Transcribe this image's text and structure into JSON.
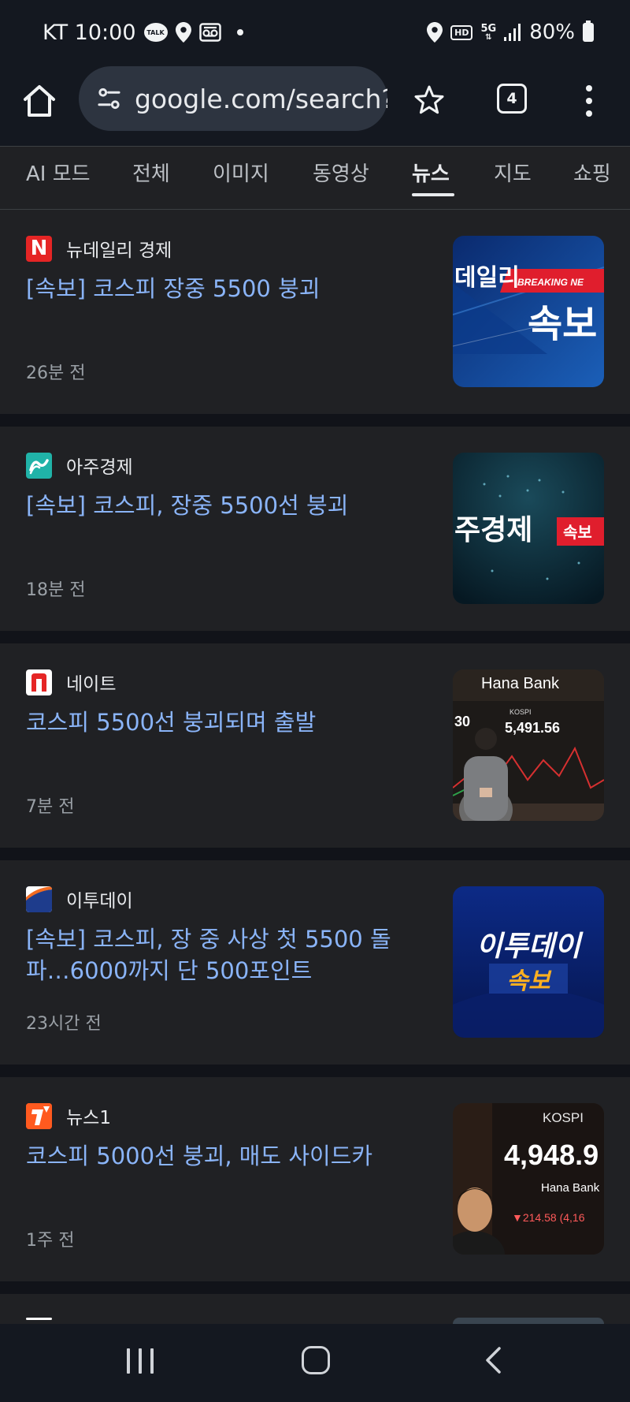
{
  "status_bar": {
    "carrier_time": "KT 10:00",
    "talk_label": "TALK",
    "hd_label": "HD",
    "network_label": "5G",
    "battery_percent": "80%"
  },
  "browser": {
    "url": "google.com/search?",
    "tab_count": "4"
  },
  "search_tabs": [
    {
      "label": "AI 모드"
    },
    {
      "label": "전체"
    },
    {
      "label": "이미지"
    },
    {
      "label": "동영상"
    },
    {
      "label": "뉴스"
    },
    {
      "label": "지도"
    },
    {
      "label": "쇼핑"
    }
  ],
  "active_tab": "뉴스",
  "news": [
    {
      "source": "뉴데일리 경제",
      "favicon_letter": "N",
      "headline": "[속보] 코스피 장중 5500 붕괴",
      "time": "26분 전",
      "thumb": {
        "brand": "데일리",
        "tag": "BREAKING NE",
        "text": "속보"
      }
    },
    {
      "source": "아주경제",
      "favicon_letter": "",
      "headline": "[속보] 코스피, 장중 5500선 붕괴",
      "time": "18분 전",
      "thumb": {
        "brand": "주경제",
        "tag": "속보"
      }
    },
    {
      "source": "네이트",
      "favicon_letter": "n",
      "headline": "코스피 5500선 붕괴되며 출발",
      "time": "7분 전",
      "thumb": {
        "brand": "Hana Bank",
        "kospi_label": "KOSPI",
        "value": "5,491.56",
        "left_num": "30"
      }
    },
    {
      "source": "이투데이",
      "favicon_letter": "",
      "headline": "[속보] 코스피, 장 중 사상 첫 5500 돌파…6000까지 단 500포인트",
      "time": "23시간 전",
      "thumb": {
        "brand": "이투데이",
        "text": "속보"
      }
    },
    {
      "source": "뉴스1",
      "favicon_letter": "1",
      "headline": "코스피 5000선 붕괴, 매도 사이드카",
      "time": "1주 전",
      "thumb": {
        "kospi_label": "KOSPI",
        "value": "4,948.9",
        "brand": "Hana Bank",
        "change": "▼214.58 (4,16"
      }
    }
  ],
  "colors": {
    "background": "#111319",
    "card": "#202124",
    "headline_link": "#8ab4f8",
    "secondary_text": "#9aa0a6"
  }
}
